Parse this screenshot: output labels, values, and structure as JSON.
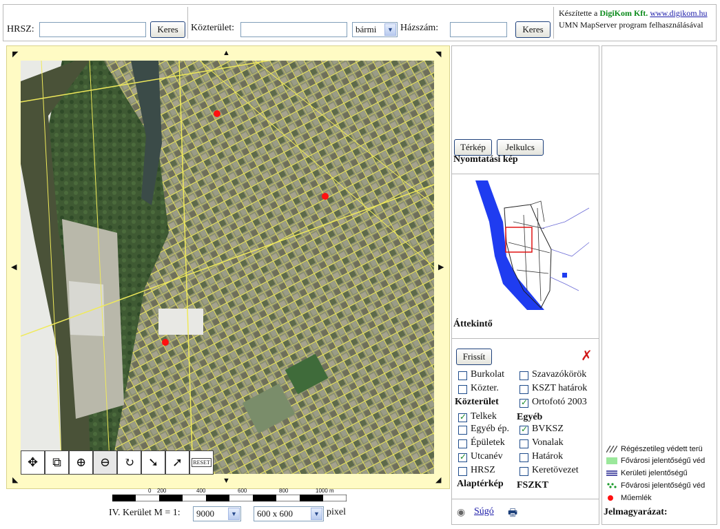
{
  "search": {
    "hrsz_label": "HRSZ:",
    "hrsz_value": "",
    "keres1": "Keres",
    "street_label": "Közterület:",
    "street_value": "",
    "street_type": "bármi",
    "house_label": "Házszám:",
    "house_value": "",
    "keres2": "Keres"
  },
  "credit": {
    "line1_prefix": "Készítette a ",
    "company": "DigiKom Kft.",
    "url": "www.digikom.hu",
    "line2": "UMN MapServer program felhasználásával"
  },
  "map": {
    "district_label": "IV. Kerület M = 1:",
    "scale_value": "9000",
    "size_value": "600 x 600",
    "size_unit": "pixel",
    "scale_ticks": [
      "0",
      "200",
      "400",
      "600",
      "800",
      "1000 m"
    ]
  },
  "tools": [
    {
      "name": "pan-icon"
    },
    {
      "name": "zoom-box-icon"
    },
    {
      "name": "zoom-in-icon"
    },
    {
      "name": "zoom-out-icon"
    },
    {
      "name": "zoom-refresh-icon"
    },
    {
      "name": "info-arrow-icon"
    },
    {
      "name": "measure-arrow-icon"
    },
    {
      "name": "reset-icon"
    }
  ],
  "print": {
    "title": "Nyomtatási kép",
    "map_btn": "Térkép",
    "legend_btn": "Jelkulcs"
  },
  "overview": {
    "title": "Áttekintő"
  },
  "layers": {
    "refresh": "Frissít",
    "alap_title": "Alaptérkép",
    "fszkt_title": "FSZKT",
    "kozterulet_title": "Közterület",
    "egyeb_title": "Egyéb",
    "alap_items": [
      {
        "label": "HRSZ",
        "checked": false
      },
      {
        "label": "Utcanév",
        "checked": true
      },
      {
        "label": "Épületek",
        "checked": false
      },
      {
        "label": "Egyéb ép.",
        "checked": false
      },
      {
        "label": "Telkek",
        "checked": true
      }
    ],
    "fszkt_items": [
      {
        "label": "Keretövezet",
        "checked": false
      },
      {
        "label": "Határok",
        "checked": false
      },
      {
        "label": "Vonalak",
        "checked": false
      },
      {
        "label": "BVKSZ",
        "checked": true
      }
    ],
    "kozter_items": [
      {
        "label": "Közter.",
        "checked": false
      },
      {
        "label": "Burkolat",
        "checked": false
      }
    ],
    "egyeb_items": [
      {
        "label": "Ortofotó 2003",
        "checked": true
      },
      {
        "label": "KSZT határok",
        "checked": false
      },
      {
        "label": "Szavazókörök",
        "checked": false
      }
    ]
  },
  "help": {
    "label": "Súgó"
  },
  "legend": {
    "title": "Jelmagyarázat:",
    "items": [
      {
        "label": "Régészetileg védett terü",
        "swatch": "hatch"
      },
      {
        "label": "Fővárosi jelentőségű véd",
        "swatch": "#9be89b"
      },
      {
        "label": "Kerületi jelentőségű",
        "swatch": "lines"
      },
      {
        "label": "Fővárosi jelentőségű véd",
        "swatch": "dots"
      },
      {
        "label": "Műemlék",
        "swatch": "red-dot"
      }
    ]
  },
  "colors": {
    "accent_blue": "#1c3f7a",
    "map_frame": "#fffbc4",
    "river": "#1f3cf0"
  }
}
